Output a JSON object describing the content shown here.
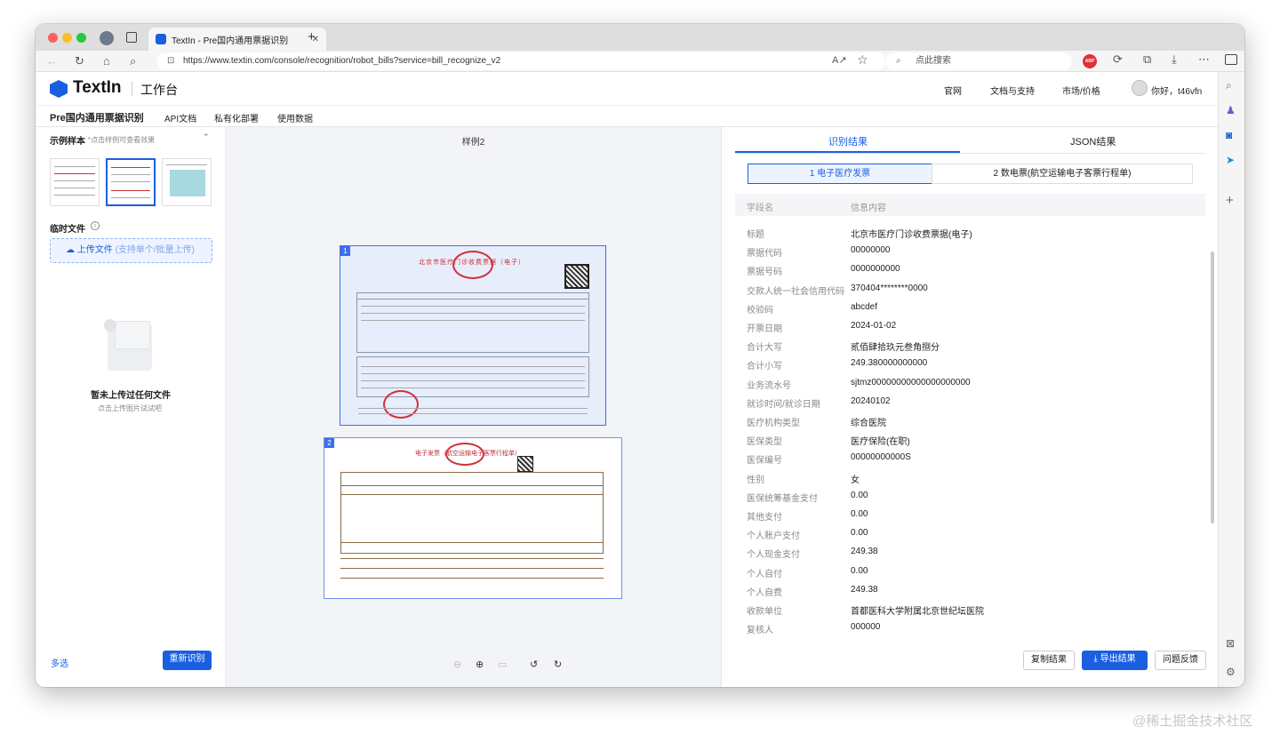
{
  "browser": {
    "tab_title": "TextIn - Pre国内通用票据识别",
    "url": "https://www.textin.com/console/recognition/robot_bills?service=bill_recognize_v2",
    "search_placeholder": "点此搜索",
    "abp": "ABP"
  },
  "header": {
    "brand": "TextIn",
    "workspace": "工作台",
    "nav": [
      "官网",
      "文档与支持",
      "市场/价格"
    ],
    "user": "你好，t46vfn"
  },
  "subnav": {
    "title": "Pre国内通用票据识别",
    "items": [
      "API文档",
      "私有化部署",
      "使用数据"
    ]
  },
  "left": {
    "samples_title": "示例样本",
    "samples_hint": "*点击样例可查看效果",
    "temp_title": "临时文件",
    "upload_label": "上传文件",
    "upload_hint": "(支持单个/批量上传)",
    "empty_title": "暂未上传过任何文件",
    "empty_hint": "点击上传图片试试吧",
    "multi": "多选",
    "rerun": "重新识别"
  },
  "middle": {
    "title": "样例2",
    "doc1": {
      "index": "1",
      "title": "北京市医疗门诊收费票据（电子）"
    },
    "doc2": {
      "index": "2",
      "title": "电子发票（航空运输电子客票行程单）"
    }
  },
  "right": {
    "tabs": [
      "识别结果",
      "JSON结果"
    ],
    "subtabs": [
      "1 电子医疗发票",
      "2 数电票(航空运输电子客票行程单)"
    ],
    "col_headers": [
      "字段名",
      "信息内容"
    ],
    "rows": [
      {
        "k": "标题",
        "v": "北京市医疗门诊收费票据(电子)"
      },
      {
        "k": "票据代码",
        "v": "00000000"
      },
      {
        "k": "票据号码",
        "v": "0000000000"
      },
      {
        "k": "交款人统一社会信用代码",
        "v": "370404********0000"
      },
      {
        "k": "校验码",
        "v": "abcdef"
      },
      {
        "k": "开票日期",
        "v": "2024-01-02"
      },
      {
        "k": "合计大写",
        "v": "贰佰肆拾玖元叁角捌分"
      },
      {
        "k": "合计小写",
        "v": "249.380000000000"
      },
      {
        "k": "业务流水号",
        "v": "sjtmz00000000000000000000"
      },
      {
        "k": "就诊时间/就诊日期",
        "v": "20240102"
      },
      {
        "k": "医疗机构类型",
        "v": "综合医院"
      },
      {
        "k": "医保类型",
        "v": "医疗保险(在职)"
      },
      {
        "k": "医保编号",
        "v": "00000000000S"
      },
      {
        "k": "性别",
        "v": "女"
      },
      {
        "k": "医保统筹基金支付",
        "v": "0.00"
      },
      {
        "k": "其他支付",
        "v": "0.00"
      },
      {
        "k": "个人账户支付",
        "v": "0.00"
      },
      {
        "k": "个人现金支付",
        "v": "249.38"
      },
      {
        "k": "个人自付",
        "v": "0.00"
      },
      {
        "k": "个人自费",
        "v": "249.38"
      },
      {
        "k": "收款单位",
        "v": "首都医科大学附属北京世纪坛医院"
      },
      {
        "k": "复核人",
        "v": "000000"
      }
    ],
    "buttons": {
      "copy": "复制结果",
      "export": "导出结果",
      "feedback": "问题反馈"
    }
  },
  "watermark": "@稀土掘金技术社区",
  "colors": {
    "accent": "#1a5fe0",
    "accent_light": "#e8f0fd",
    "stamp": "#d0303a"
  }
}
